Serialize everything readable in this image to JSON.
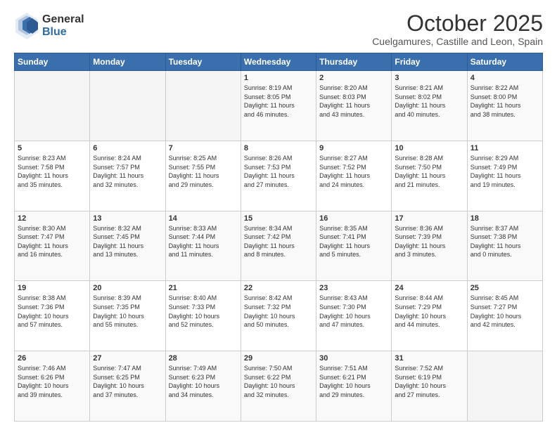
{
  "logo": {
    "general": "General",
    "blue": "Blue"
  },
  "title": {
    "main": "October 2025",
    "sub": "Cuelgamures, Castille and Leon, Spain"
  },
  "weekdays": [
    "Sunday",
    "Monday",
    "Tuesday",
    "Wednesday",
    "Thursday",
    "Friday",
    "Saturday"
  ],
  "weeks": [
    [
      {
        "day": "",
        "info": ""
      },
      {
        "day": "",
        "info": ""
      },
      {
        "day": "",
        "info": ""
      },
      {
        "day": "1",
        "info": "Sunrise: 8:19 AM\nSunset: 8:05 PM\nDaylight: 11 hours\nand 46 minutes."
      },
      {
        "day": "2",
        "info": "Sunrise: 8:20 AM\nSunset: 8:03 PM\nDaylight: 11 hours\nand 43 minutes."
      },
      {
        "day": "3",
        "info": "Sunrise: 8:21 AM\nSunset: 8:02 PM\nDaylight: 11 hours\nand 40 minutes."
      },
      {
        "day": "4",
        "info": "Sunrise: 8:22 AM\nSunset: 8:00 PM\nDaylight: 11 hours\nand 38 minutes."
      }
    ],
    [
      {
        "day": "5",
        "info": "Sunrise: 8:23 AM\nSunset: 7:58 PM\nDaylight: 11 hours\nand 35 minutes."
      },
      {
        "day": "6",
        "info": "Sunrise: 8:24 AM\nSunset: 7:57 PM\nDaylight: 11 hours\nand 32 minutes."
      },
      {
        "day": "7",
        "info": "Sunrise: 8:25 AM\nSunset: 7:55 PM\nDaylight: 11 hours\nand 29 minutes."
      },
      {
        "day": "8",
        "info": "Sunrise: 8:26 AM\nSunset: 7:53 PM\nDaylight: 11 hours\nand 27 minutes."
      },
      {
        "day": "9",
        "info": "Sunrise: 8:27 AM\nSunset: 7:52 PM\nDaylight: 11 hours\nand 24 minutes."
      },
      {
        "day": "10",
        "info": "Sunrise: 8:28 AM\nSunset: 7:50 PM\nDaylight: 11 hours\nand 21 minutes."
      },
      {
        "day": "11",
        "info": "Sunrise: 8:29 AM\nSunset: 7:49 PM\nDaylight: 11 hours\nand 19 minutes."
      }
    ],
    [
      {
        "day": "12",
        "info": "Sunrise: 8:30 AM\nSunset: 7:47 PM\nDaylight: 11 hours\nand 16 minutes."
      },
      {
        "day": "13",
        "info": "Sunrise: 8:32 AM\nSunset: 7:45 PM\nDaylight: 11 hours\nand 13 minutes."
      },
      {
        "day": "14",
        "info": "Sunrise: 8:33 AM\nSunset: 7:44 PM\nDaylight: 11 hours\nand 11 minutes."
      },
      {
        "day": "15",
        "info": "Sunrise: 8:34 AM\nSunset: 7:42 PM\nDaylight: 11 hours\nand 8 minutes."
      },
      {
        "day": "16",
        "info": "Sunrise: 8:35 AM\nSunset: 7:41 PM\nDaylight: 11 hours\nand 5 minutes."
      },
      {
        "day": "17",
        "info": "Sunrise: 8:36 AM\nSunset: 7:39 PM\nDaylight: 11 hours\nand 3 minutes."
      },
      {
        "day": "18",
        "info": "Sunrise: 8:37 AM\nSunset: 7:38 PM\nDaylight: 11 hours\nand 0 minutes."
      }
    ],
    [
      {
        "day": "19",
        "info": "Sunrise: 8:38 AM\nSunset: 7:36 PM\nDaylight: 10 hours\nand 57 minutes."
      },
      {
        "day": "20",
        "info": "Sunrise: 8:39 AM\nSunset: 7:35 PM\nDaylight: 10 hours\nand 55 minutes."
      },
      {
        "day": "21",
        "info": "Sunrise: 8:40 AM\nSunset: 7:33 PM\nDaylight: 10 hours\nand 52 minutes."
      },
      {
        "day": "22",
        "info": "Sunrise: 8:42 AM\nSunset: 7:32 PM\nDaylight: 10 hours\nand 50 minutes."
      },
      {
        "day": "23",
        "info": "Sunrise: 8:43 AM\nSunset: 7:30 PM\nDaylight: 10 hours\nand 47 minutes."
      },
      {
        "day": "24",
        "info": "Sunrise: 8:44 AM\nSunset: 7:29 PM\nDaylight: 10 hours\nand 44 minutes."
      },
      {
        "day": "25",
        "info": "Sunrise: 8:45 AM\nSunset: 7:27 PM\nDaylight: 10 hours\nand 42 minutes."
      }
    ],
    [
      {
        "day": "26",
        "info": "Sunrise: 7:46 AM\nSunset: 6:26 PM\nDaylight: 10 hours\nand 39 minutes."
      },
      {
        "day": "27",
        "info": "Sunrise: 7:47 AM\nSunset: 6:25 PM\nDaylight: 10 hours\nand 37 minutes."
      },
      {
        "day": "28",
        "info": "Sunrise: 7:49 AM\nSunset: 6:23 PM\nDaylight: 10 hours\nand 34 minutes."
      },
      {
        "day": "29",
        "info": "Sunrise: 7:50 AM\nSunset: 6:22 PM\nDaylight: 10 hours\nand 32 minutes."
      },
      {
        "day": "30",
        "info": "Sunrise: 7:51 AM\nSunset: 6:21 PM\nDaylight: 10 hours\nand 29 minutes."
      },
      {
        "day": "31",
        "info": "Sunrise: 7:52 AM\nSunset: 6:19 PM\nDaylight: 10 hours\nand 27 minutes."
      },
      {
        "day": "",
        "info": ""
      }
    ]
  ]
}
